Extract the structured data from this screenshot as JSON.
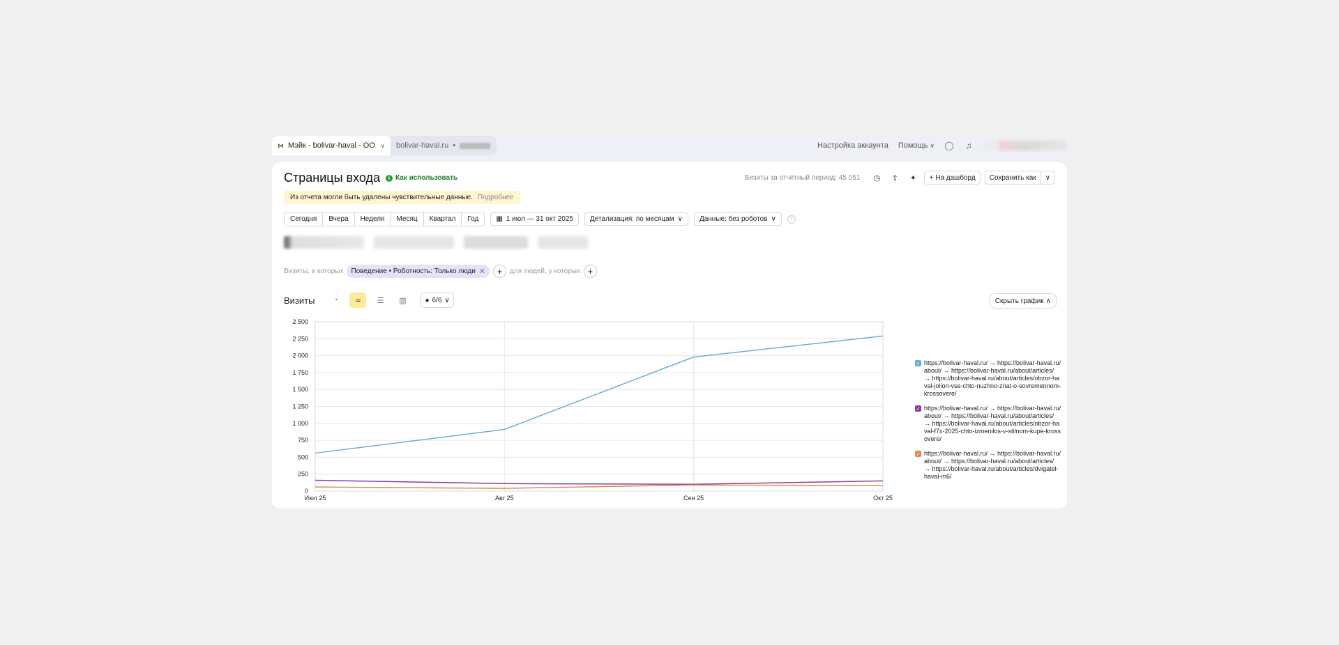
{
  "topbar": {
    "counter_name": "Мэйк - bolivar-haval - ОО...",
    "site_name": "bolivar-haval.ru",
    "site_separator": "•",
    "account_settings": "Настройка аккаунта",
    "help": "Помощь"
  },
  "header": {
    "title": "Страницы входа",
    "how_to_use": "Как использовать",
    "visits_total": "Визиты за отчётный период: 45 051",
    "to_dashboard": "На дашборд",
    "save_as": "Сохранить как"
  },
  "notice": {
    "text": "Из отчета могли быть удалены чувствительные данные.",
    "more": "Подробнее"
  },
  "periods": [
    "Сегодня",
    "Вчера",
    "Неделя",
    "Месяц",
    "Квартал",
    "Год"
  ],
  "date_range": "1 июл — 31 окт 2025",
  "detail": "Детализация: по месяцам",
  "data_filter": "Данные: без роботов",
  "segments": {
    "visits_label": "Визиты, в которых",
    "chip": "Поведение • Роботность: Только люди",
    "people_label": "для людей, у которых"
  },
  "chart_header": {
    "title": "Визиты",
    "series_count": "6/6",
    "hide": "Скрыть график"
  },
  "colors": {
    "series1": "#6baed6",
    "series2": "#8e3c97",
    "series3": "#e08a4f",
    "grid": "#e6e6e6"
  },
  "chart_data": {
    "type": "line",
    "x": [
      "Июл 25",
      "Авг 25",
      "Сен 25",
      "Окт 25"
    ],
    "y_ticks": [
      "2 500",
      "2 250",
      "2 000",
      "1 750",
      "1 500",
      "1 250",
      "1 000",
      "750",
      "500",
      "250",
      "0"
    ],
    "ylim": [
      0,
      2500
    ],
    "grid": true,
    "legend_position": "right",
    "series": [
      {
        "name": "https://bolivar-haval.ru/ → https://bolivar-haval.ru/about/ → https://bolivar-haval.ru/about/articles/ → https://bolivar-haval.ru/about/articles/obzor-haval-jolion-vse-chto-nuzhno-znat-o-sovremennom-krossovere/",
        "values": [
          560,
          910,
          1980,
          2290
        ]
      },
      {
        "name": "https://bolivar-haval.ru/ → https://bolivar-haval.ru/about/ → https://bolivar-haval.ru/about/articles/ → https://bolivar-haval.ru/about/articles/obzor-haval-f7x-2025-chto-izmenilos-v-stilnom-kupe-krossovere/",
        "values": [
          160,
          110,
          100,
          150
        ]
      },
      {
        "name": "https://bolivar-haval.ru/ → https://bolivar-haval.ru/about/ → https://bolivar-haval.ru/about/articles/ → https://bolivar-haval.ru/about/articles/dvigatel-haval-m6/",
        "values": [
          60,
          40,
          90,
          80
        ]
      }
    ]
  }
}
